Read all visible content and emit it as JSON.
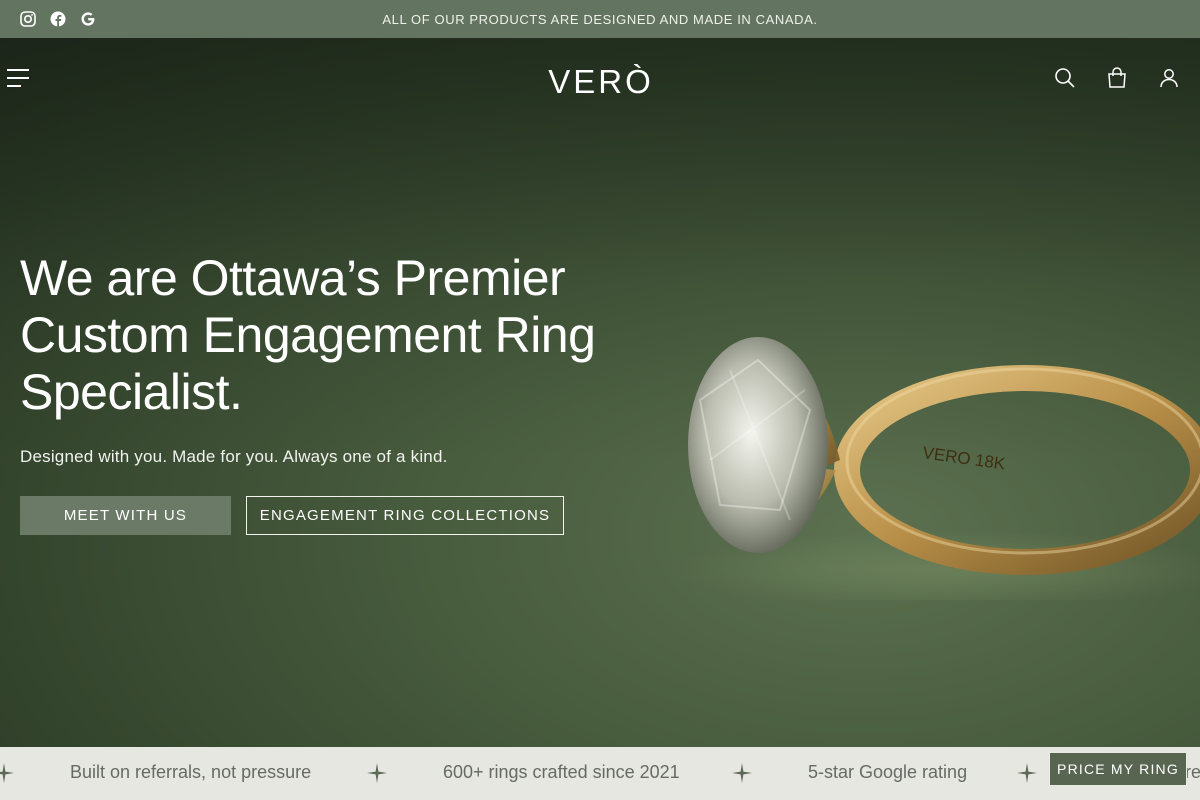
{
  "announcement": "ALL OF OUR PRODUCTS ARE DESIGNED AND MADE IN CANADA.",
  "social_icons": [
    "instagram-icon",
    "facebook-icon",
    "google-icon"
  ],
  "header": {
    "logo_text": "VERÒ",
    "icons": [
      "menu-icon",
      "search-icon",
      "cart-icon",
      "account-icon"
    ]
  },
  "hero": {
    "headline": "We are Ottawa’s Premier Custom Engagement Ring Specialist.",
    "subheadline": "Designed with you. Made for you. Always one of a kind.",
    "primary_button": "MEET WITH US",
    "secondary_button": "ENGAGEMENT RING COLLECTIONS",
    "ring_engraving": "VERO 18K"
  },
  "ticker": {
    "items": [
      "Built on referrals, not pressure",
      "600+ rings crafted since 2021",
      "5-star Google rating",
      "ere"
    ],
    "separator_icon": "sparkle-icon"
  },
  "floating_button": "PRICE MY RING",
  "colors": {
    "announcement_bg": "#637460",
    "hero_green": "#485c3e",
    "primary_button_bg": "#6b7a67",
    "ticker_bg": "#e7e7e2",
    "price_button_bg": "#586651"
  }
}
